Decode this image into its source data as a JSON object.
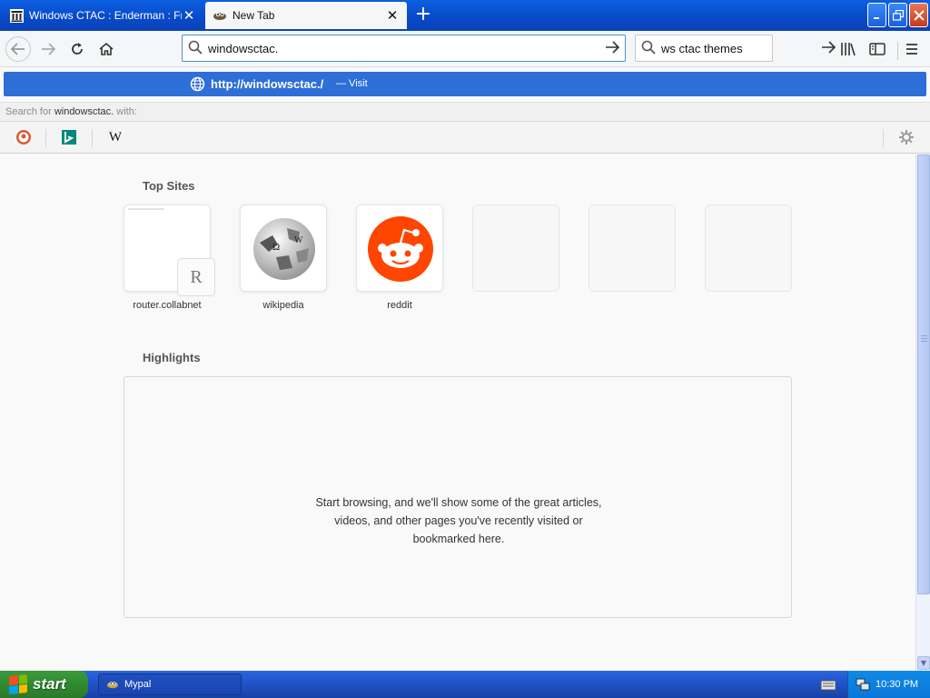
{
  "tabs": [
    {
      "label": "Windows CTAC : Enderman : Free",
      "active": false
    },
    {
      "label": "New Tab",
      "active": true
    }
  ],
  "url": {
    "value": "windowsctac."
  },
  "search": {
    "value": "ws ctac themes"
  },
  "suggestion": {
    "url": "http://windowsctac./",
    "visit": "— Visit"
  },
  "search_for": {
    "prefix": "Search for",
    "query": "windowsctac.",
    "suffix": "with:"
  },
  "engines": [
    "duckduckgo-icon",
    "bing-icon",
    "wikipedia-icon"
  ],
  "top_sites": {
    "title": "Top Sites",
    "tiles": [
      {
        "label": "router.collabnet",
        "badge": "R"
      },
      {
        "label": "wikipedia"
      },
      {
        "label": "reddit"
      },
      {
        "label": ""
      },
      {
        "label": ""
      },
      {
        "label": ""
      }
    ]
  },
  "highlights": {
    "title": "Highlights",
    "empty_line1": "Start browsing, and we'll show some of the great articles,",
    "empty_line2": "videos, and other pages you've recently visited or",
    "empty_line3": "bookmarked here."
  },
  "taskbar": {
    "start": "start",
    "item": "Mypal",
    "time": "10:30 PM"
  },
  "colors": {
    "accent": "#2d6fd6",
    "reddit": "#ff4500",
    "taskbar": "#245edb",
    "start": "#2f8a2f"
  }
}
